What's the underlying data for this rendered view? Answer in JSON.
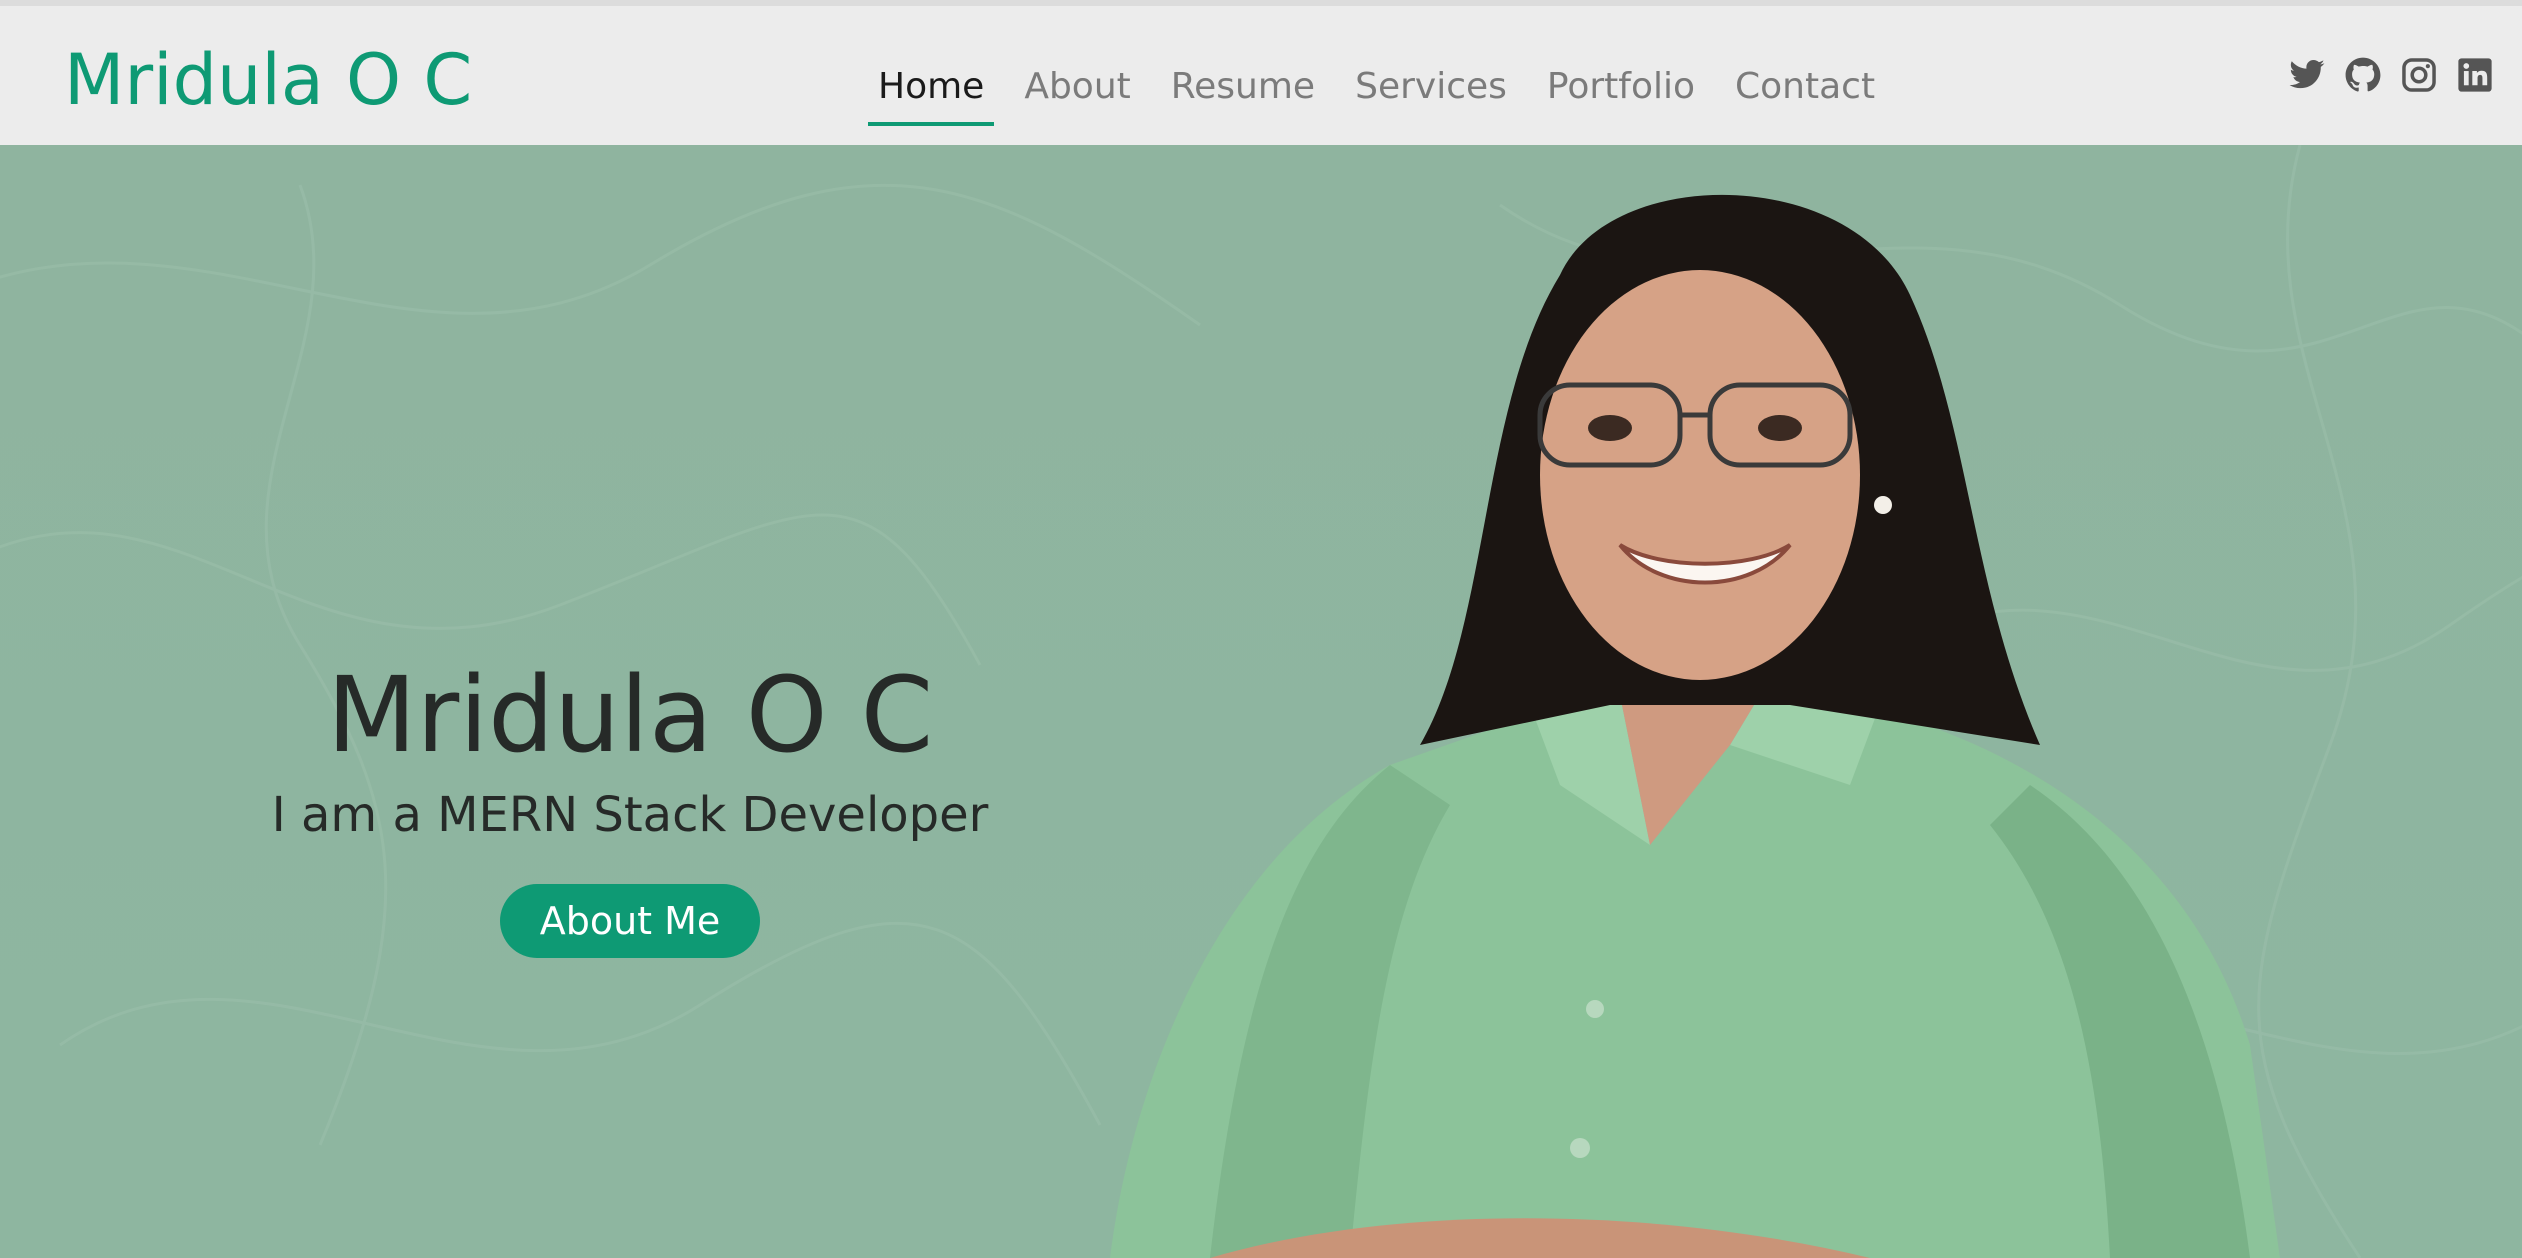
{
  "header": {
    "brand": "Mridula O C",
    "nav": [
      {
        "label": "Home",
        "active": true
      },
      {
        "label": "About",
        "active": false
      },
      {
        "label": "Resume",
        "active": false
      },
      {
        "label": "Services",
        "active": false
      },
      {
        "label": "Portfolio",
        "active": false
      },
      {
        "label": "Contact",
        "active": false
      }
    ],
    "social_icons": [
      "twitter-icon",
      "github-icon",
      "instagram-icon",
      "linkedin-icon"
    ]
  },
  "hero": {
    "name": "Mridula O C",
    "tagline": "I am a MERN Stack Developer",
    "button_label": "About Me"
  },
  "colors": {
    "accent": "#0e9a74",
    "header_bg": "#ececec",
    "hero_bg": "#8fb5a0",
    "nav_inactive": "#7b7b7b",
    "text_dark": "#262a28"
  }
}
